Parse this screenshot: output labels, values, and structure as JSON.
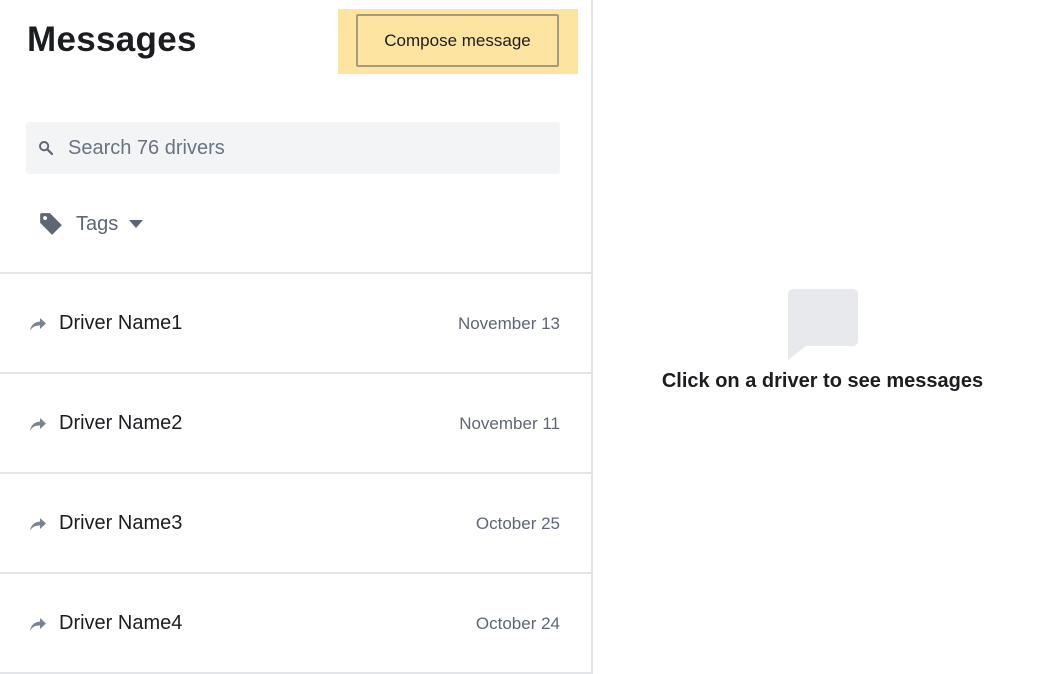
{
  "header": {
    "title": "Messages",
    "compose_label": "Compose message"
  },
  "search": {
    "placeholder": "Search 76 drivers",
    "value": ""
  },
  "filters": {
    "tags_label": "Tags"
  },
  "drivers": [
    {
      "name": "Driver Name1",
      "date": "November 13"
    },
    {
      "name": "Driver Name2",
      "date": "November 11"
    },
    {
      "name": "Driver Name3",
      "date": "October 25"
    },
    {
      "name": "Driver Name4",
      "date": "October 24"
    }
  ],
  "empty_state": {
    "text": "Click on a driver to see messages",
    "icon": "chat-bubble-icon"
  },
  "icons": {
    "search": "search-icon",
    "tag": "tag-icon",
    "caret": "chevron-down-icon",
    "forward": "forward-arrow-icon"
  },
  "colors": {
    "compose_highlight": "#fde4a1",
    "search_bg": "#f3f4f6",
    "divider": "#e3e5e8",
    "muted_text": "#5e6673"
  }
}
